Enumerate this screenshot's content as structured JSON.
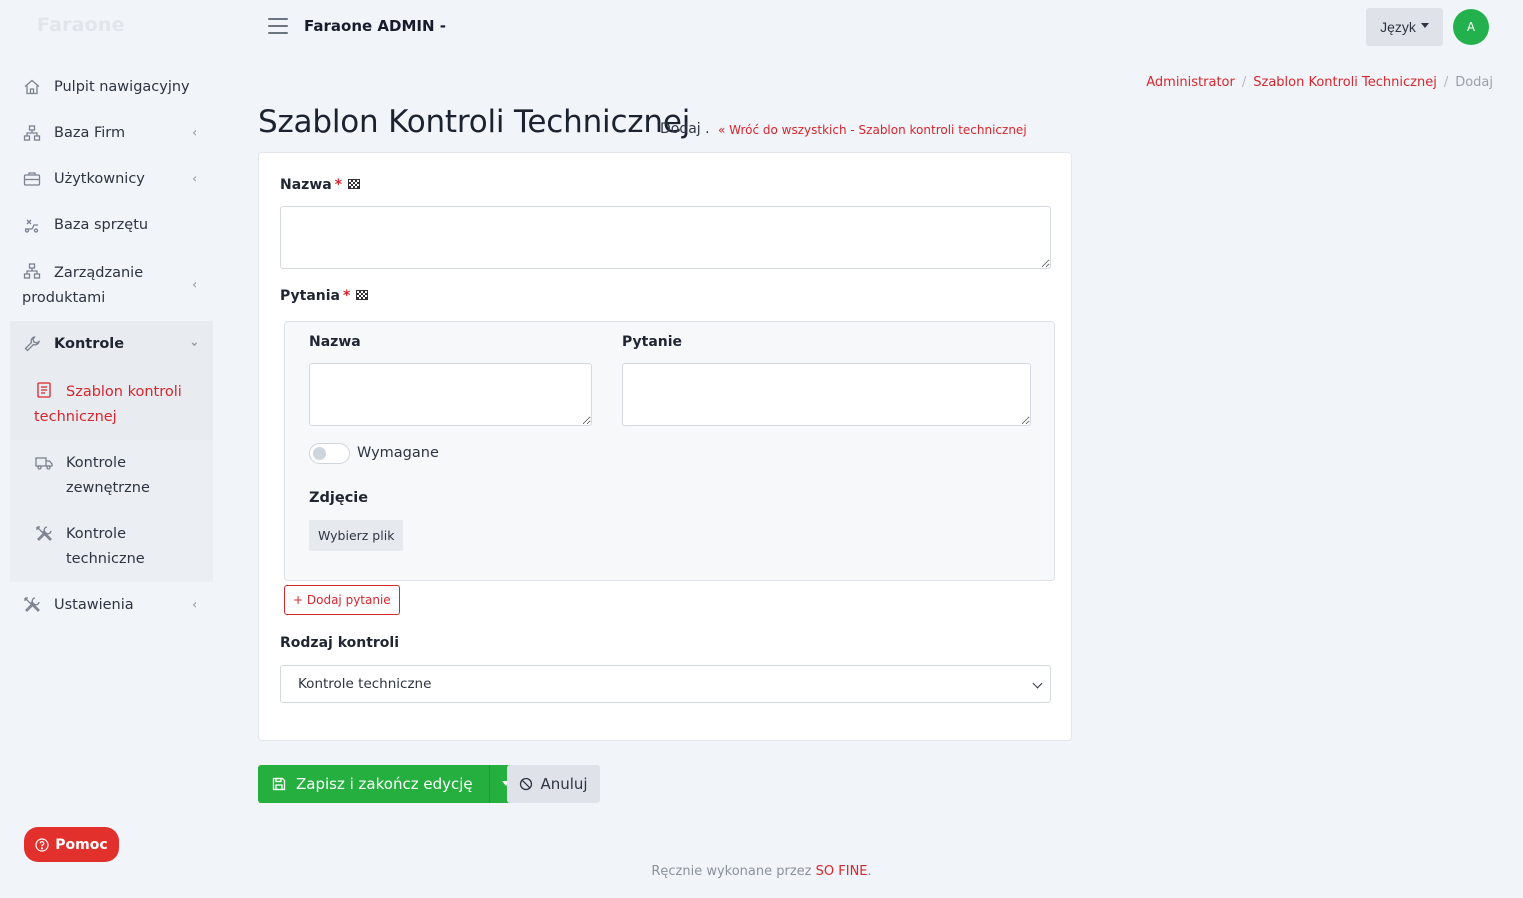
{
  "sidebar": {
    "brand": "Faraone",
    "items": [
      {
        "label": "Pulpit nawigacyjny",
        "icon": "home-icon"
      },
      {
        "label": "Baza Firm",
        "icon": "sitemap-icon"
      },
      {
        "label": "Użytkownicy",
        "icon": "briefcase-icon"
      },
      {
        "label": "Baza sprzętu",
        "icon": "equipment-icon"
      },
      {
        "label": "Zarządzanie produktami",
        "icon": "sitemap-icon"
      },
      {
        "label": "Kontrole",
        "icon": "wrench-icon"
      },
      {
        "label": "Szablon kontroli technicznej",
        "icon": "document-icon"
      },
      {
        "label": "Kontrole zewnętrzne",
        "icon": "truck-icon"
      },
      {
        "label": "Kontrole techniczne",
        "icon": "tools-icon"
      },
      {
        "label": "Ustawienia",
        "icon": "tools-icon"
      }
    ]
  },
  "header": {
    "title": "Faraone ADMIN -",
    "language_label": "Język",
    "avatar_initial": "A"
  },
  "breadcrumb": {
    "items": [
      "Administrator",
      "Szablon Kontroli Technicznej",
      "Dodaj"
    ]
  },
  "page": {
    "title": "Szablon Kontroli Technicznej",
    "action": "Dodaj .",
    "back_link": "« Wróć do wszystkich - Szablon kontroli technicznej"
  },
  "form": {
    "name_label": "Nazwa",
    "required_mark": "*",
    "questions_label": "Pytania",
    "question": {
      "name_label": "Nazwa",
      "question_label": "Pytanie",
      "required_toggle_label": "Wymagane",
      "photo_label": "Zdjęcie",
      "file_button_label": "Wybierz plik"
    },
    "add_question_label": "+ Dodaj pytanie",
    "control_type_label": "Rodzaj kontroli",
    "control_type_value": "Kontrole techniczne"
  },
  "actions": {
    "save_label": "Zapisz i zakończ edycję",
    "cancel_label": "Anuluj"
  },
  "help": {
    "label": "Pomoc"
  },
  "footer": {
    "prefix": "Ręcznie wykonane przez",
    "link": "SO FINE",
    "suffix": "."
  },
  "colors": {
    "accent": "#d7262e",
    "success": "#24af3f",
    "background": "#f1f4f8"
  }
}
